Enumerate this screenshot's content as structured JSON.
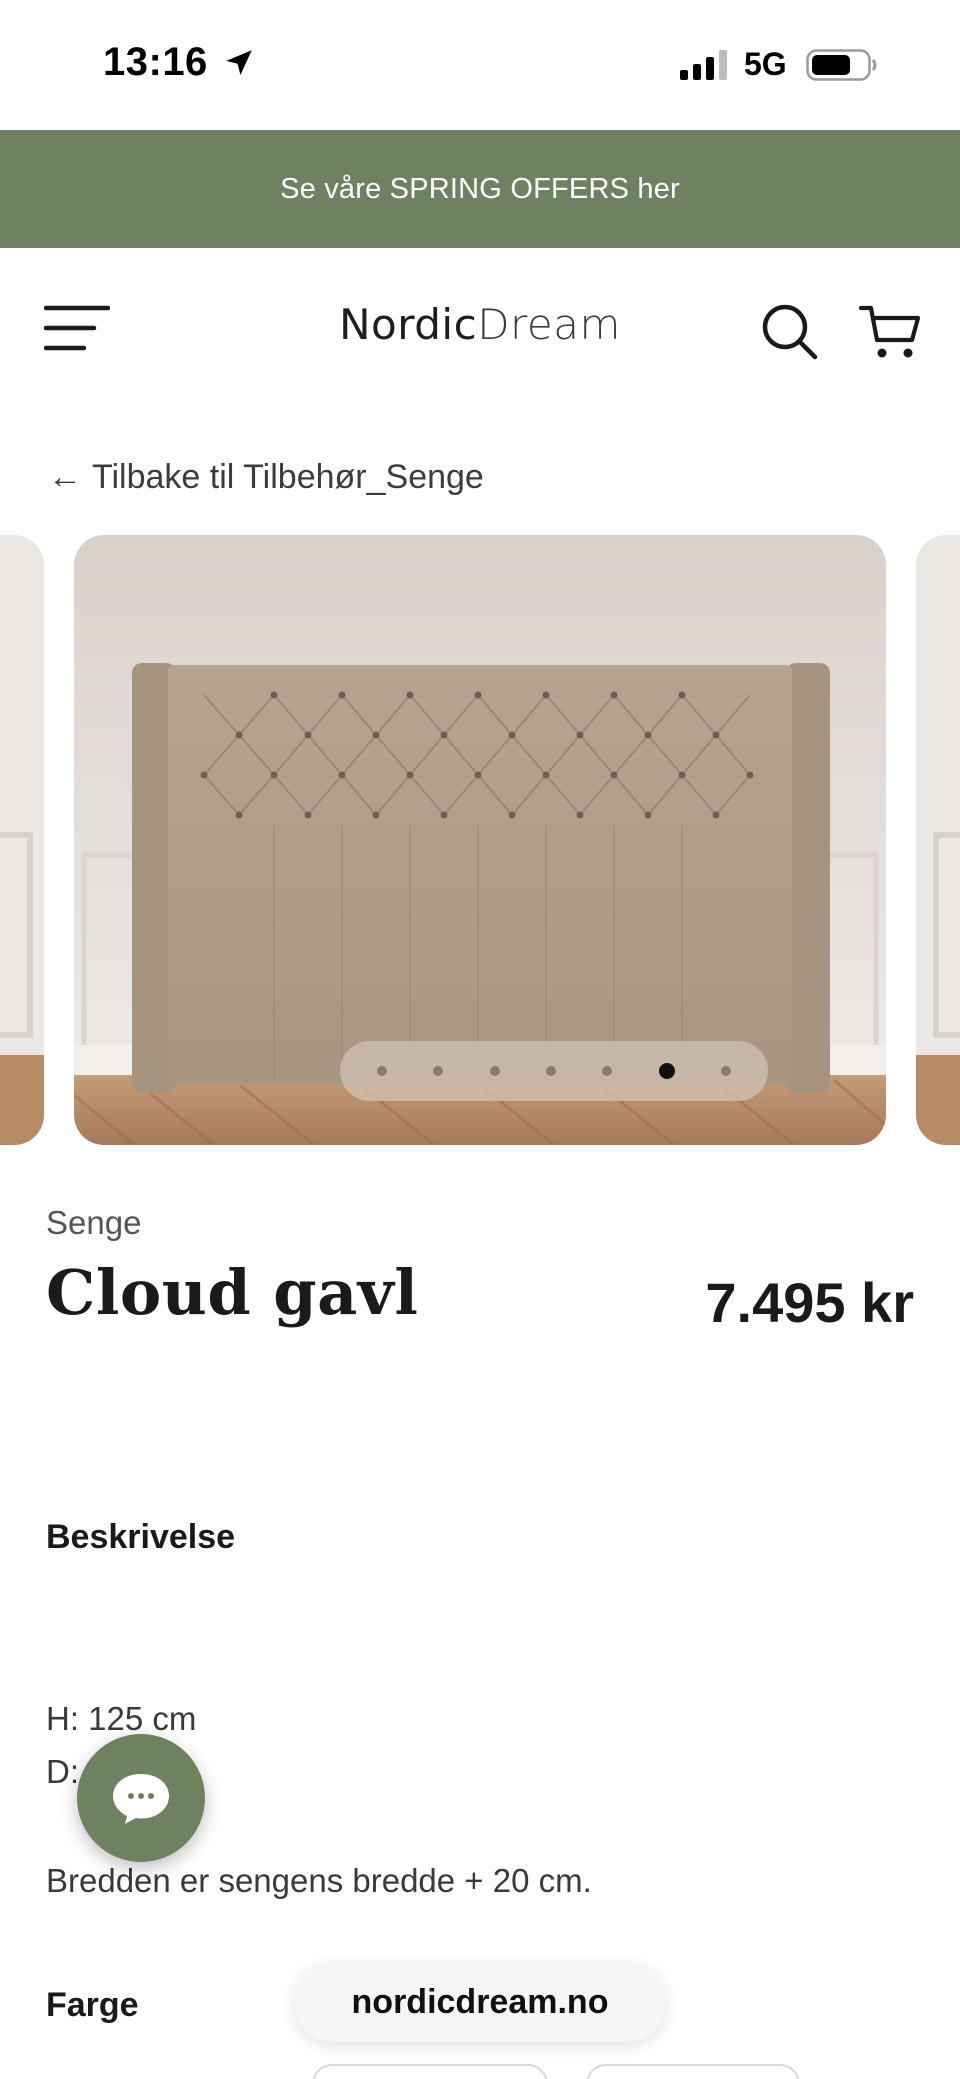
{
  "status_bar": {
    "time": "13:16",
    "network": "5G",
    "location_icon": "location-arrow-icon",
    "signal_icon": "cellular-signal-icon",
    "battery_icon": "battery-icon"
  },
  "promo_banner": {
    "text": "Se våre SPRING OFFERS her",
    "background": "#6e8161"
  },
  "header": {
    "brand_bold": "Nordic",
    "brand_light": "Dream",
    "menu_icon": "hamburger-menu-icon",
    "search_icon": "search-icon",
    "cart_icon": "cart-icon"
  },
  "back_link": {
    "arrow": "←",
    "label": "Tilbake til Tilbehør_Senge"
  },
  "carousel": {
    "slide_count": 7,
    "active_index": 5
  },
  "product": {
    "category": "Senge",
    "title": "Cloud gavl",
    "price": "7.495 kr"
  },
  "description": {
    "heading": "Beskrivelse",
    "height": "H: 125 cm",
    "depth": "D:",
    "width_note": "Bredden er sengens bredde + 20 cm."
  },
  "color_section": {
    "heading": "Farge"
  },
  "chat": {
    "icon": "chat-bubble-icon",
    "background": "#6e8161"
  },
  "browser": {
    "domain": "nordicdream.no"
  }
}
